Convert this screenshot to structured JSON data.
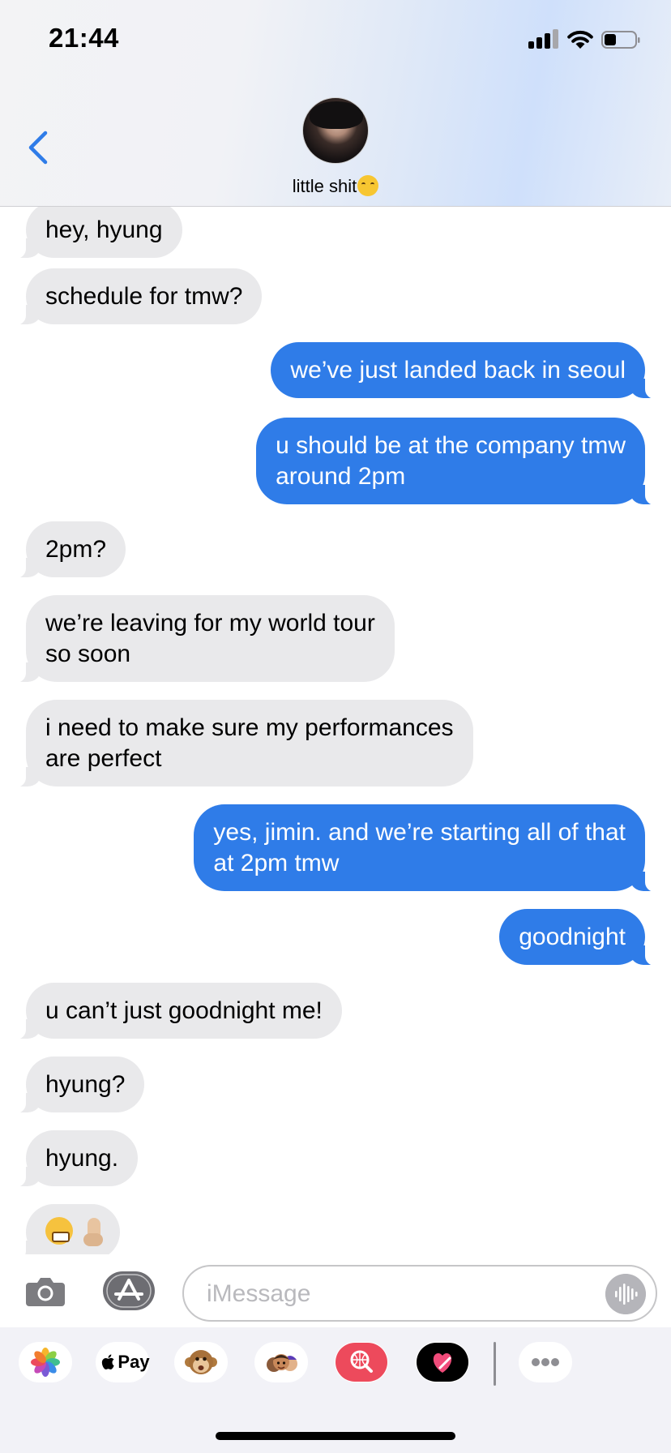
{
  "status_bar": {
    "time": "21:44"
  },
  "header": {
    "contact_name": "little shit"
  },
  "messages": [
    {
      "direction": "incoming",
      "text": "hey, hyung"
    },
    {
      "direction": "incoming",
      "text": "schedule for tmw?"
    },
    {
      "direction": "outgoing",
      "text": "we’ve just landed back in seoul"
    },
    {
      "direction": "outgoing",
      "line1": "u should be at the company tmw",
      "line2": "around 2pm"
    },
    {
      "direction": "incoming",
      "text": "2pm?"
    },
    {
      "direction": "incoming",
      "line1": "we’re leaving for my world tour",
      "line2": "so soon"
    },
    {
      "direction": "incoming",
      "line1": "i need to make sure my performances",
      "line2": "are perfect"
    },
    {
      "direction": "outgoing",
      "line1": "yes, jimin. and we’re starting all of that",
      "line2": "at 2pm tmw"
    },
    {
      "direction": "outgoing",
      "text": "goodnight"
    },
    {
      "direction": "incoming",
      "text": "u can’t just goodnight me!"
    },
    {
      "direction": "incoming",
      "text": "hyung?"
    },
    {
      "direction": "incoming",
      "text": "hyung."
    },
    {
      "direction": "incoming",
      "emoji": [
        "face-with-steam-from-nose-icon",
        "middle-finger-icon"
      ]
    }
  ],
  "composer": {
    "placeholder": "iMessage"
  },
  "app_drawer": {
    "apple_pay_label": "Pay",
    "apps": [
      "photos-icon",
      "apple-pay-icon",
      "animoji-monkey-icon",
      "memoji-icon",
      "image-search-icon",
      "digital-touch-heart-icon",
      "more-apps-icon"
    ]
  },
  "colors": {
    "outgoing_bubble": "#2f7ce8",
    "incoming_bubble": "#e9e9eb",
    "accent": "#2f7ce8"
  }
}
